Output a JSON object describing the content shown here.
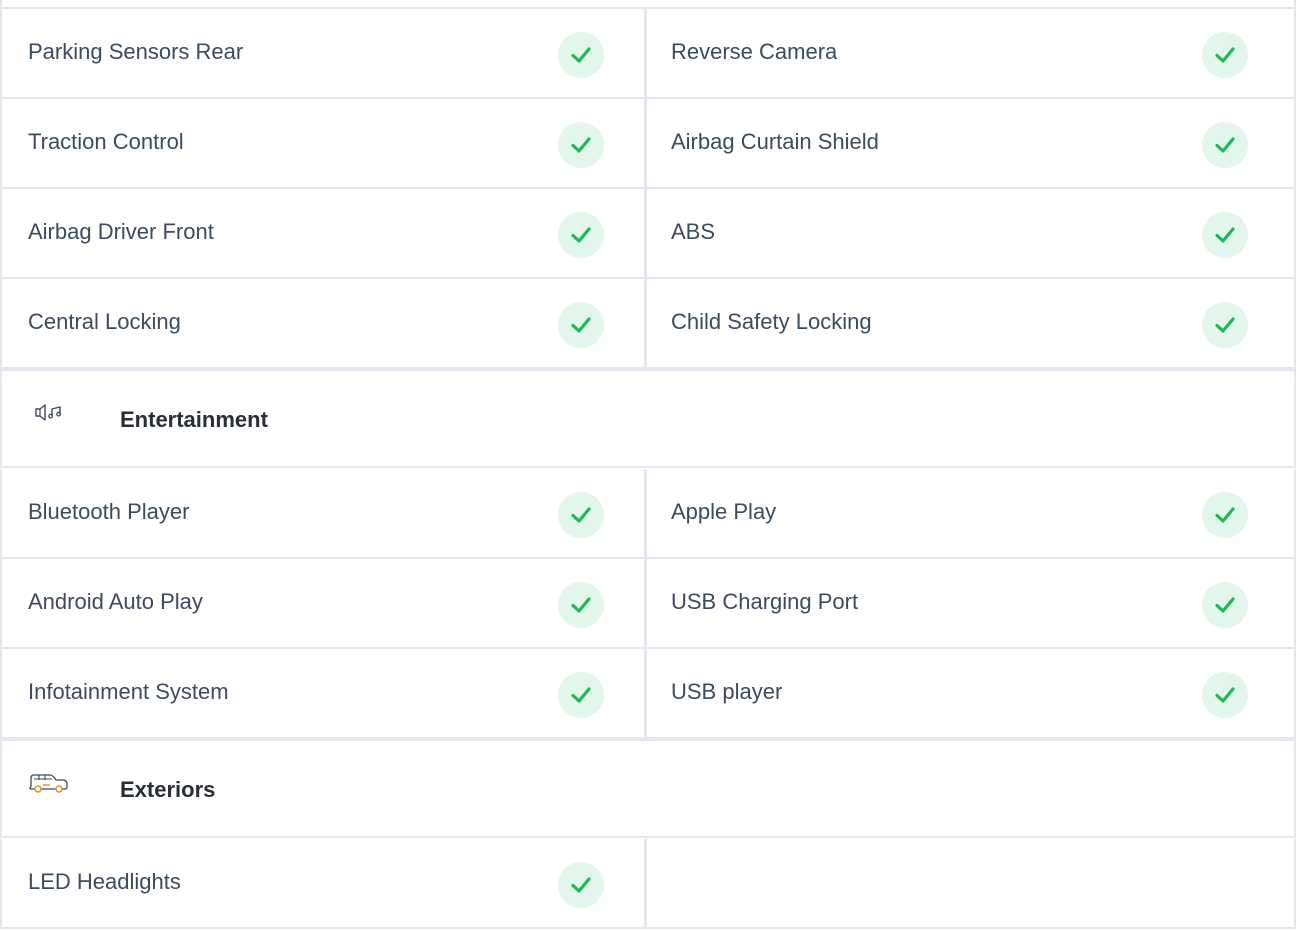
{
  "colors": {
    "border": "#e3e8ee",
    "check_bg": "#e3f6ec",
    "check_mark": "#1db954",
    "text": "#3b4c5f",
    "heading": "#2a2f35",
    "exteriors_icon_accent": "#f08a24"
  },
  "safety_rows": [
    {
      "left": "Parking Sensors Rear",
      "right": "Reverse Camera"
    },
    {
      "left": "Traction Control",
      "right": "Airbag Curtain Shield"
    },
    {
      "left": "Airbag Driver Front",
      "right": "ABS"
    },
    {
      "left": "Central Locking",
      "right": "Child Safety Locking"
    }
  ],
  "entertainment": {
    "title": "Entertainment",
    "icon": "speaker-music-icon",
    "rows": [
      {
        "left": "Bluetooth Player",
        "right": "Apple Play"
      },
      {
        "left": "Android Auto Play",
        "right": "USB Charging Port"
      },
      {
        "left": "Infotainment System",
        "right": "USB player"
      }
    ]
  },
  "exteriors": {
    "title": "Exteriors",
    "icon": "car-icon",
    "rows": [
      {
        "left": "LED Headlights",
        "right": ""
      }
    ]
  },
  "check_icon": "check-icon"
}
